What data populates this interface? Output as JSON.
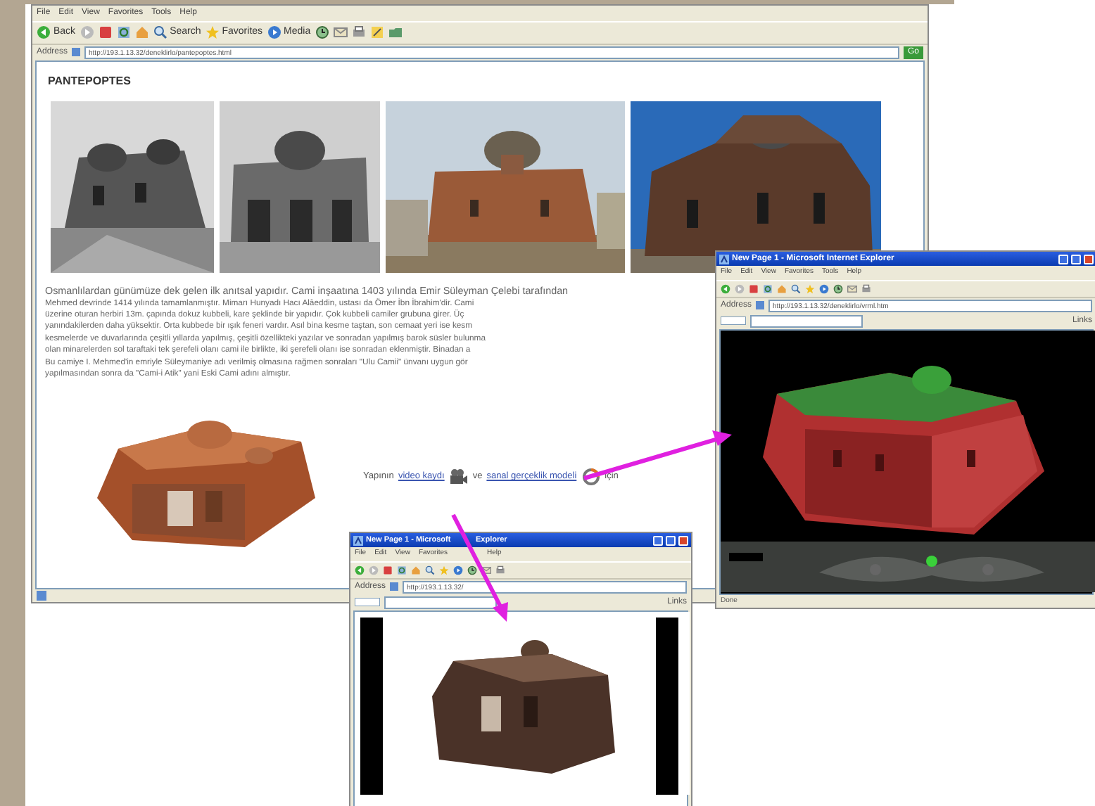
{
  "main_window": {
    "menu": [
      "File",
      "Edit",
      "View",
      "Favorites",
      "Tools",
      "Help"
    ],
    "toolbar": [
      {
        "kind": "back",
        "label": "Back"
      },
      {
        "kind": "forward"
      },
      {
        "kind": "stop"
      },
      {
        "kind": "refresh"
      },
      {
        "kind": "home"
      },
      {
        "kind": "search",
        "label": "Search"
      },
      {
        "kind": "favorites",
        "label": "Favorites"
      },
      {
        "kind": "media",
        "label": "Media"
      },
      {
        "kind": "history"
      },
      {
        "kind": "mail"
      },
      {
        "kind": "print"
      },
      {
        "kind": "edit"
      },
      {
        "kind": "folder"
      }
    ],
    "address_label": "Address",
    "url": "http://193.1.13.32/deneklirlo/pantepoptes.html",
    "go": "Go",
    "heading": "PANTEPOPTES",
    "paragraph_lines": [
      "Osmanlılardan günümüze dek gelen ilk anıtsal yapıdır. Cami inşaatına 1403 yılında Emir Süleyman Çelebi tarafından",
      "Mehmed devrinde 1414 yılında tamamlanmıştır. Mimarı Hunyadı Hacı Alâeddin, ustası da Ömer İbn İbrahim'dir. Cami",
      "üzerine oturan herbiri 13m. çapında dokuz kubbeli, kare şeklinde bir yapıdır. Çok kubbeli camiler grubuna girer. Üç",
      "yanındakilerden daha yüksektir. Orta kubbede bir ışık feneri vardır. Asıl bina kesme taştan, son cemaat yeri ise kesm",
      "kesmelerde ve duvarlarında çeşitli yıllarda yapılmış, çeşitli özellikteki yazılar ve sonradan yapılmış barok süsler bulunma",
      "olan minarelerden sol taraftaki tek şerefeli olanı cami ile birlikte, iki şerefeli olanı ise sonradan eklenmiştir. Binadan a",
      "Bu camiye I. Mehmed'in emriyle Süleymaniye adı verilmiş olmasına rağmen sonraları \"Ulu Camii\" ünvanı uygun gör",
      "yapılmasından sonra da \"Cami-i Atik\" yani Eski Cami adını almıştır."
    ],
    "link_line": {
      "prefix": "Yapının",
      "link1": "video kaydı",
      "middle": "ve",
      "link2": "sanal gerçeklik modeli",
      "suffix": "için"
    }
  },
  "vr_window": {
    "title": "New Page 1 - Microsoft Internet Explorer",
    "menu": [
      "File",
      "Edit",
      "View",
      "Favorites",
      "Tools",
      "Help"
    ],
    "address_label": "Address",
    "url": "http://193.1.13.32/deneklirlo/vrml.htm",
    "links_label": "Links",
    "status": "Done"
  },
  "video_window": {
    "title_parts": [
      "New Page 1 - Microsoft",
      "Explorer"
    ],
    "menu": [
      "File",
      "Edit",
      "View",
      "Favorites",
      "Help"
    ],
    "address_label": "Address",
    "url": "http://193.1.13.32/",
    "links_label": "Links"
  }
}
